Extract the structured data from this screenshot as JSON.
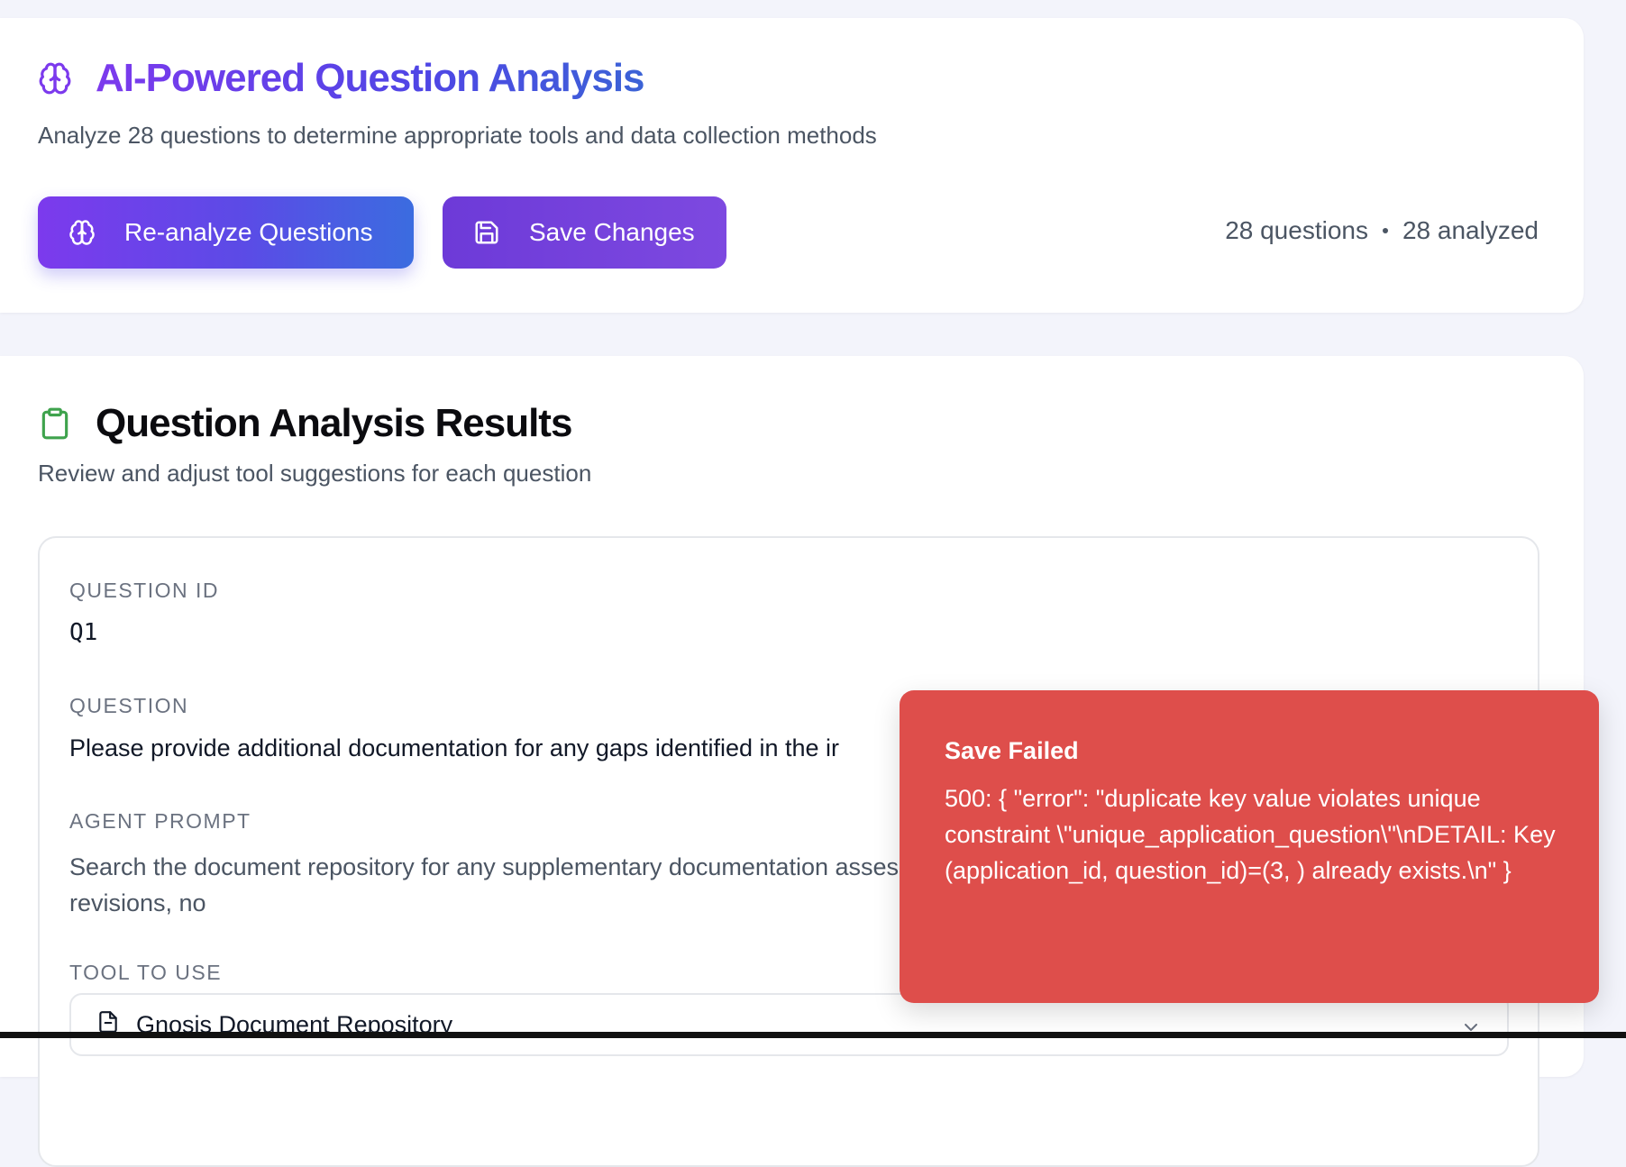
{
  "analysis_header": {
    "icon": "brain-icon",
    "title": "AI-Powered Question Analysis",
    "subtitle": "Analyze 28 questions to determine appropriate tools and data collection methods",
    "reanalyze_label": "Re-analyze Questions",
    "save_label": "Save Changes",
    "stats": {
      "questions": "28 questions",
      "analyzed": "28 analyzed"
    }
  },
  "results": {
    "icon": "clipboard-icon",
    "title": "Question Analysis Results",
    "subtitle": "Review and adjust tool suggestions for each question",
    "question": {
      "id_label": "QUESTION ID",
      "id_value": "Q1",
      "question_label": "QUESTION",
      "question_value": "Please provide additional documentation for any gaps identified in the ir",
      "prompt_label": "AGENT PROMPT",
      "prompt_value": "Search the document repository for any supplementary documentation assessment of the Follow-up General process. Include any revisions, no",
      "tool_label": "TOOL TO USE",
      "tool_value": "Gnosis Document Repository"
    }
  },
  "toast": {
    "title": "Save Failed",
    "message": "500: { \"error\": \"duplicate key value violates unique constraint \\\"unique_application_question\\\"\\nDETAIL: Key (application_id, question_id)=(3, ) already exists.\\n\" }"
  },
  "colors": {
    "accent_purple": "#7c3aed",
    "accent_blue": "#3b6ce0",
    "error_red": "#de4e4b",
    "clipboard_green": "#3fa34d"
  }
}
